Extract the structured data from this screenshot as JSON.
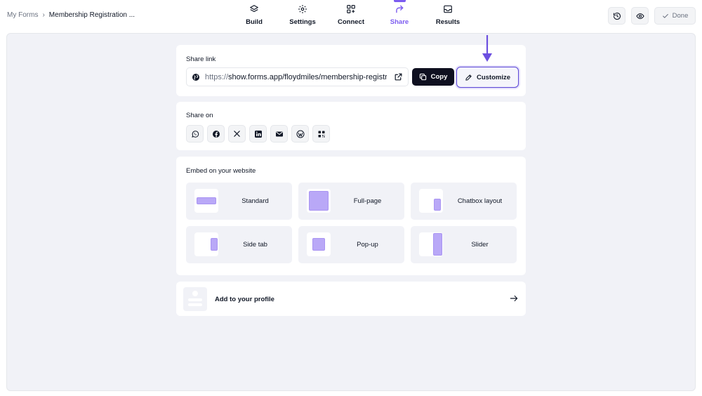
{
  "breadcrumb": {
    "root": "My Forms",
    "separator": "›",
    "current": "Membership Registration ..."
  },
  "nav": {
    "build": "Build",
    "settings": "Settings",
    "connect": "Connect",
    "share": "Share",
    "results": "Results",
    "active": "Share"
  },
  "toolbar": {
    "done": "Done"
  },
  "share_link": {
    "title": "Share link",
    "url_protocol": "https://",
    "url_rest": "show.forms.app/floydmiles/membership-registration",
    "copy": "Copy",
    "customize": "Customize"
  },
  "share_on": {
    "title": "Share on",
    "icons": [
      "whatsapp-icon",
      "facebook-icon",
      "x-icon",
      "linkedin-icon",
      "email-icon",
      "wordpress-icon",
      "qr-code-icon"
    ]
  },
  "embed": {
    "title": "Embed on your website",
    "options": [
      {
        "label": "Standard",
        "icon": "standard-embed-icon"
      },
      {
        "label": "Full-page",
        "icon": "full-page-embed-icon"
      },
      {
        "label": "Chatbox layout",
        "icon": "chatbox-embed-icon"
      },
      {
        "label": "Side tab",
        "icon": "side-tab-embed-icon"
      },
      {
        "label": "Pop-up",
        "icon": "popup-embed-icon"
      },
      {
        "label": "Slider",
        "icon": "slider-embed-icon"
      }
    ]
  },
  "profile": {
    "label": "Add to your profile"
  },
  "colors": {
    "accent": "#7c5cf0",
    "dark_button": "#0f1020",
    "canvas": "#f1f2f7",
    "embed_shape": "#b9a8f7"
  }
}
